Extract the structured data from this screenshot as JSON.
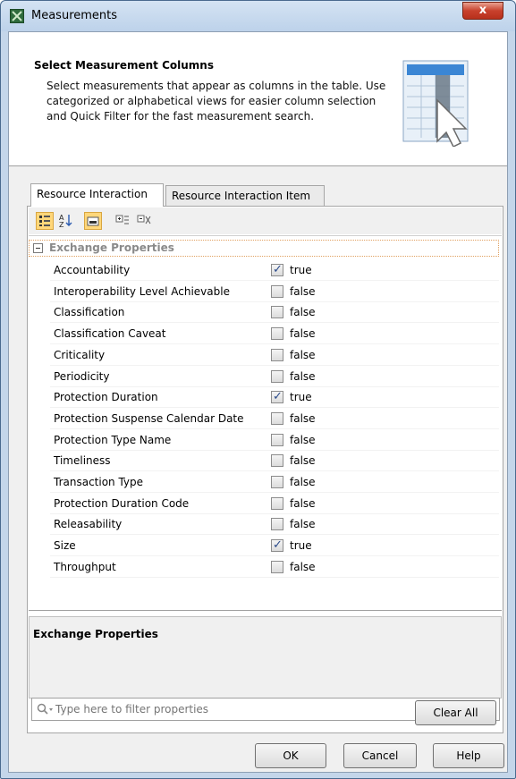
{
  "window": {
    "title": "Measurements",
    "close_glyph": "x"
  },
  "header": {
    "title": "Select Measurement Columns",
    "description": "Select measurements that appear as columns in the table. Use categorized or alphabetical views for easier column selection and Quick Filter for the fast measurement search.",
    "graphic_icon": "table-columns-cursor-icon"
  },
  "tabs": [
    {
      "label": "Resource Interaction",
      "active": true
    },
    {
      "label": "Resource Interaction Item",
      "active": false
    }
  ],
  "toolbar": {
    "icons": [
      "categorized-view-icon",
      "alphabetical-sort-icon",
      "show-description-icon",
      "expand-all-icon",
      "collapse-all-icon"
    ]
  },
  "group": {
    "label": "Exchange Properties",
    "expanded": true
  },
  "properties": [
    {
      "name": "Accountability",
      "checked": true,
      "value": "true"
    },
    {
      "name": "Interoperability Level Achievable",
      "checked": false,
      "value": "false"
    },
    {
      "name": "Classification",
      "checked": false,
      "value": "false"
    },
    {
      "name": "Classification Caveat",
      "checked": false,
      "value": "false"
    },
    {
      "name": "Criticality",
      "checked": false,
      "value": "false"
    },
    {
      "name": "Periodicity",
      "checked": false,
      "value": "false"
    },
    {
      "name": "Protection Duration",
      "checked": true,
      "value": "true"
    },
    {
      "name": "Protection Suspense Calendar Date",
      "checked": false,
      "value": "false"
    },
    {
      "name": "Protection Type Name",
      "checked": false,
      "value": "false"
    },
    {
      "name": "Timeliness",
      "checked": false,
      "value": "false"
    },
    {
      "name": "Transaction Type",
      "checked": false,
      "value": "false"
    },
    {
      "name": "Protection Duration Code",
      "checked": false,
      "value": "false"
    },
    {
      "name": "Releasability",
      "checked": false,
      "value": "false"
    },
    {
      "name": "Size",
      "checked": true,
      "value": "true"
    },
    {
      "name": "Throughput",
      "checked": false,
      "value": "false"
    }
  ],
  "description_panel": {
    "title": "Exchange Properties"
  },
  "filter": {
    "placeholder": "Type here to filter properties",
    "value": ""
  },
  "buttons": {
    "clear_all": "Clear All",
    "ok": "OK",
    "cancel": "Cancel",
    "help": "Help"
  },
  "colors": {
    "accent_pressed": "#ffd77a",
    "group_label": "#8a8a8a",
    "title_bar": "#c4d6ea",
    "checkmark": "#2a4a8a"
  }
}
